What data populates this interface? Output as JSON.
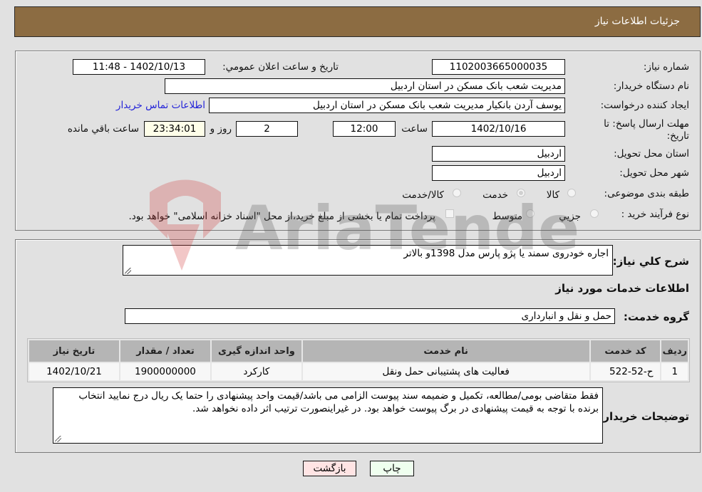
{
  "header": {
    "title": "جزئيات اطلاعات نياز"
  },
  "details": {
    "need_number_label": "شماره نیاز:",
    "need_number": "1102003665000035",
    "announce_label": "تاريخ و ساعت اعلان عمومي:",
    "announce_value": "1402/10/13 - 11:48",
    "buyer_org_label": "نام دستگاه خریدار:",
    "buyer_org": "مدیریت شعب بانک مسکن در استان اردبیل",
    "creator_label": "ایجاد کننده درخواست:",
    "creator": "یوسف  آردن بانکیار مدیریت شعب بانک مسکن در استان اردبیل",
    "contact_link": "اطلاعات تماس خریدار",
    "deadline_label": "مهلت ارسال پاسخ: تا تاریخ:",
    "deadline_date": "1402/10/16",
    "time_label": "ساعت",
    "deadline_time": "12:00",
    "days_value": "2",
    "days_label": "روز و",
    "remaining_time": "23:34:01",
    "remaining_label": "ساعت باقي مانده",
    "province_label": "استان محل تحویل:",
    "province": "اردبیل",
    "city_label": "شهر محل تحویل:",
    "city": "اردبیل",
    "category_label": "طبقه بندی موضوعی:",
    "category_options": [
      "کالا",
      "خدمت",
      "کالا/خدمت"
    ],
    "category_selected": "خدمت",
    "process_label": "نوع فرآیند خرید :",
    "process_options": [
      "جزيي",
      "متوسط"
    ],
    "payment_note": "پرداخت تمام یا بخشی از مبلغ خرید،از محل \"اسناد خزانه اسلامی\" خواهد بود."
  },
  "summary": {
    "description_label": "شرح کلي نياز:",
    "description": "اجاره خودروی سمند یا پژو پارس مدل 1398و بالاتر",
    "services_heading": "اطلاعات خدمات مورد نياز",
    "service_group_label": "گروه خدمت:",
    "service_group": "حمل و نقل و انبارداری"
  },
  "table": {
    "headers": [
      "رديف",
      "کد خدمت",
      "نام خدمت",
      "واحد اندازه گيری",
      "تعداد / مقدار",
      "تاريخ نياز"
    ],
    "rows": [
      [
        "1",
        "ح-52-522",
        "فعالیت های پشتیبانی حمل ونقل",
        "کارکرد",
        "1900000000",
        "1402/10/21"
      ]
    ]
  },
  "buyer_notes": {
    "label": "توضيحات خريدار:",
    "text": "فقط متقاضی بومی/مطالعه، تکمیل و ضمیمه سند پیوست الزامی می باشد/قیمت واحد پیشنهادی را حتما یک ریال درج نمایید انتخاب برنده با توجه به قیمت پیشنهادی در برگ پیوست خواهد بود. در غیراینصورت ترتیب اثر داده نخواهد شد."
  },
  "buttons": {
    "print": "چاپ",
    "back": "بازگشت"
  },
  "watermark": {
    "text": "AriaTender.neT"
  },
  "colors": {
    "header_bg": "#8c6c42",
    "link": "#2323d8",
    "print_bg": "#efffef",
    "back_bg": "#ffe4e4"
  }
}
